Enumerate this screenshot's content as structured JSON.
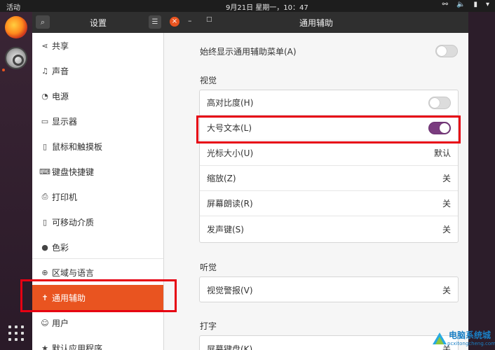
{
  "topbar": {
    "activities": "活动",
    "clock": "9月21日 星期一，10：47",
    "tray_icons": [
      "network-icon",
      "volume-icon",
      "battery-icon",
      "chevron-down-icon"
    ]
  },
  "window": {
    "sidebar_title": "设置",
    "panel_title": "通用辅助"
  },
  "sidebar": {
    "items": [
      {
        "label": "共享",
        "icon": "share-icon"
      },
      {
        "label": "声音",
        "icon": "music-note-icon"
      },
      {
        "label": "电源",
        "icon": "power-icon"
      },
      {
        "label": "显示器",
        "icon": "display-icon"
      },
      {
        "label": "鼠标和触摸板",
        "icon": "mouse-icon"
      },
      {
        "label": "键盘快捷键",
        "icon": "keyboard-icon"
      },
      {
        "label": "打印机",
        "icon": "printer-icon"
      },
      {
        "label": "可移动介质",
        "icon": "removable-media-icon"
      },
      {
        "label": "色彩",
        "icon": "color-icon"
      },
      {
        "label": "区域与语言",
        "icon": "globe-icon"
      },
      {
        "label": "通用辅助",
        "icon": "accessibility-icon",
        "active": true
      },
      {
        "label": "用户",
        "icon": "users-icon"
      },
      {
        "label": "默认应用程序",
        "icon": "star-icon"
      }
    ]
  },
  "content": {
    "always_show_menu": {
      "label": "始终显示通用辅助菜单(A)",
      "on": false
    },
    "vision": {
      "title": "视觉",
      "rows": [
        {
          "label": "高对比度(H)",
          "type": "toggle",
          "on": false
        },
        {
          "label": "大号文本(L)",
          "type": "toggle",
          "on": true
        },
        {
          "label": "光标大小(U)",
          "type": "value",
          "value": "默认"
        },
        {
          "label": "缩放(Z)",
          "type": "value",
          "value": "关"
        },
        {
          "label": "屏幕朗读(R)",
          "type": "value",
          "value": "关"
        },
        {
          "label": "发声键(S)",
          "type": "value",
          "value": "关"
        }
      ]
    },
    "hearing": {
      "title": "听觉",
      "rows": [
        {
          "label": "视觉警报(V)",
          "type": "value",
          "value": "关"
        }
      ]
    },
    "typing": {
      "title": "打字",
      "rows": [
        {
          "label": "屏幕键盘(K)",
          "type": "value",
          "value": "关"
        }
      ]
    }
  },
  "colors": {
    "accent": "#e95420",
    "toggle_on": "#7a3c7f",
    "highlight": "#e60012"
  },
  "watermark": {
    "line1": "电脑系统城",
    "line2": "pcxitongcheng.com"
  }
}
